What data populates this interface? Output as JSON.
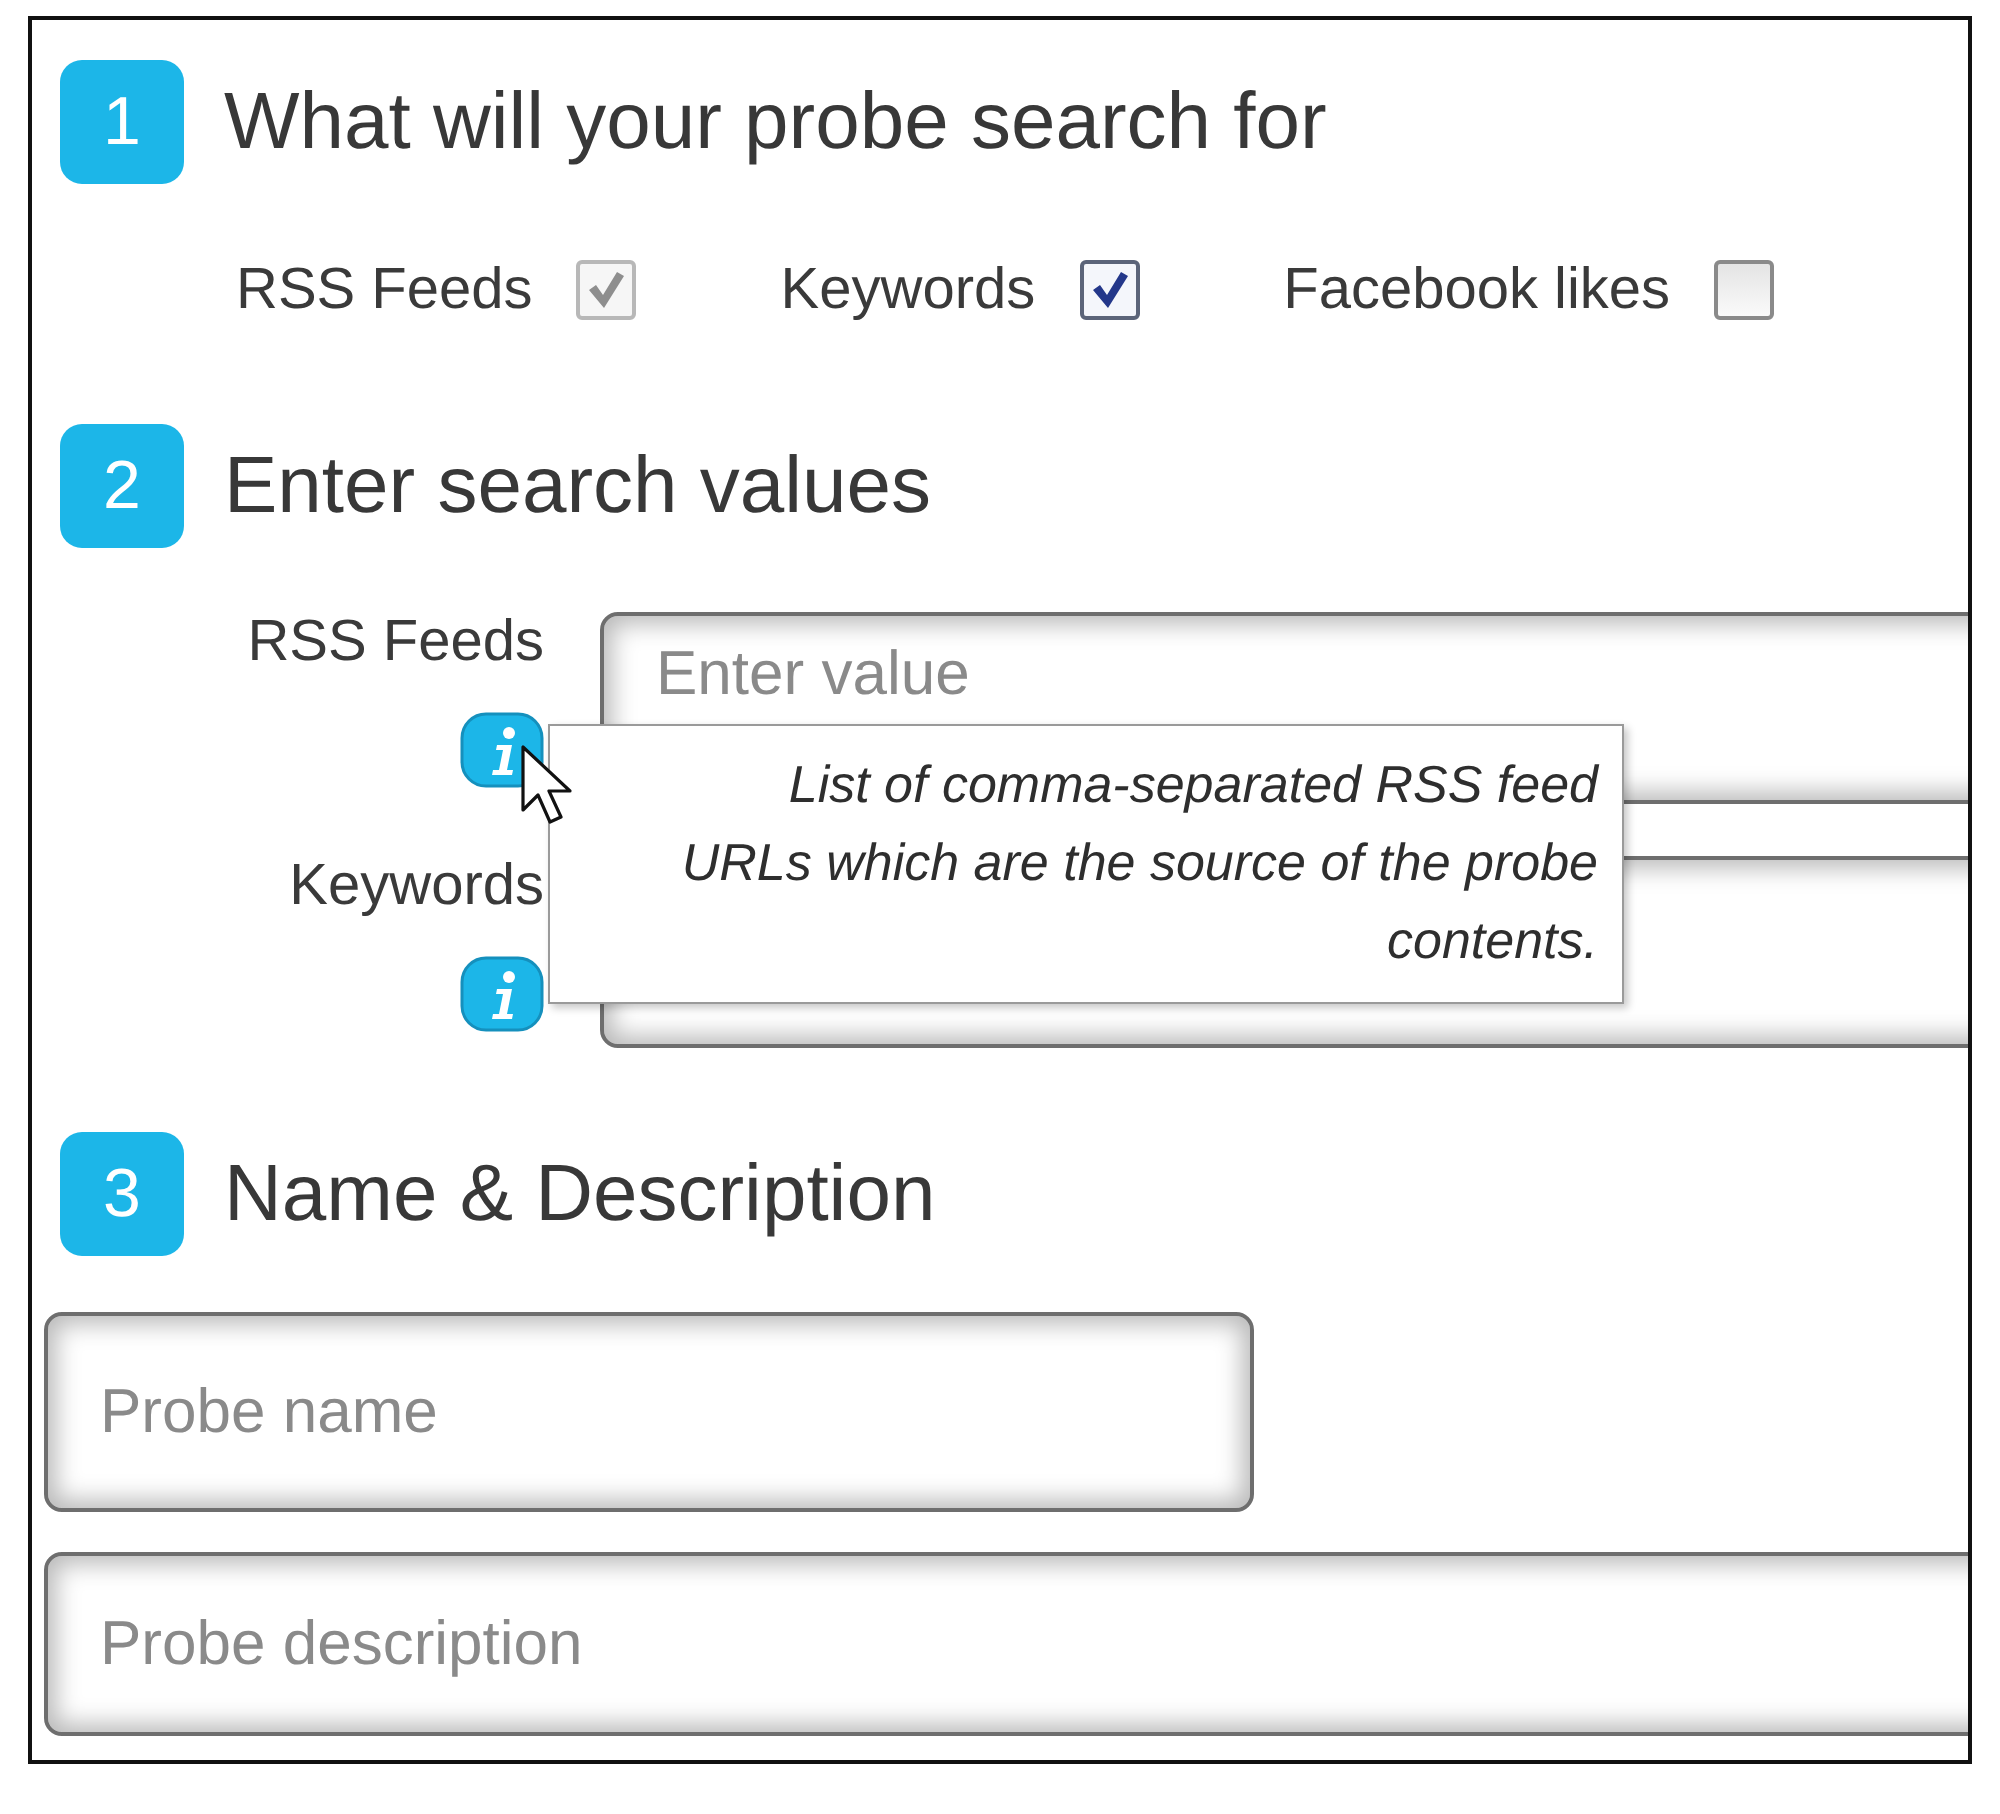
{
  "sections": [
    {
      "number": "1",
      "title": "What will your probe search for",
      "kind": "checkboxes",
      "options": [
        {
          "label": "RSS Feeds",
          "checked": true,
          "disabled": true
        },
        {
          "label": "Keywords",
          "checked": true,
          "disabled": false
        },
        {
          "label": "Facebook likes",
          "checked": false,
          "disabled": false
        }
      ]
    },
    {
      "number": "2",
      "title": "Enter search values",
      "kind": "labeled_fields",
      "fields": [
        {
          "label": "RSS Feeds",
          "placeholder": "Enter value",
          "tooltip": "List of comma-separated RSS feed\nURLs which are the source of the probe\ncontents."
        },
        {
          "label": "Keywords"
        }
      ]
    },
    {
      "number": "3",
      "title": "Name & Description",
      "kind": "plain_fields",
      "fields": [
        {
          "placeholder": "Probe name"
        },
        {
          "placeholder": "Probe description"
        }
      ]
    }
  ]
}
